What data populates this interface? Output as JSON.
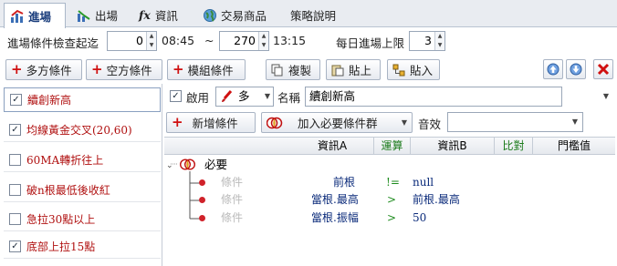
{
  "tabs": [
    {
      "label": "進場",
      "icon": "chart-entry-icon"
    },
    {
      "label": "出場",
      "icon": "chart-exit-icon"
    },
    {
      "label": "資訊",
      "icon": "fx-icon",
      "prefix": "fx"
    },
    {
      "label": "交易商品",
      "icon": "globe-icon"
    },
    {
      "label": "策略說明",
      "icon": ""
    }
  ],
  "settings": {
    "check_label": "進場條件檢查起迄",
    "start_value": "0",
    "start_time": "08:45",
    "range_sep": "~",
    "end_value": "270",
    "end_time": "13:15",
    "daily_label": "每日進場上限",
    "daily_value": "3"
  },
  "toolbar": {
    "long_cond": "多方條件",
    "short_cond": "空方條件",
    "module_cond": "模組條件",
    "copy": "複製",
    "paste1": "貼上",
    "paste2": "貼入"
  },
  "conditions": [
    {
      "label": "續創新高",
      "checked": true
    },
    {
      "label": "均線黃金交叉(20,60)",
      "checked": true
    },
    {
      "label": "60MA轉折往上",
      "checked": false
    },
    {
      "label": "破n根最低後收紅",
      "checked": false
    },
    {
      "label": "急拉30點以上",
      "checked": false
    },
    {
      "label": "底部上拉15點",
      "checked": true
    }
  ],
  "detail": {
    "enable_label": "啟用",
    "direction": "多",
    "name_label": "名稱",
    "name_value": "續創新高",
    "add_cond": "新增條件",
    "add_group": "加入必要條件群",
    "sound_label": "音效",
    "sound_value": ""
  },
  "grid": {
    "headers": [
      "資訊A",
      "運算",
      "資訊B",
      "比對",
      "門檻值"
    ],
    "group_label": "必要",
    "rows": [
      {
        "label": "條件",
        "a": "前根",
        "op": "!=",
        "b": "null"
      },
      {
        "label": "條件",
        "a": "當根.最高",
        "op": ">",
        "b": "前根.最高"
      },
      {
        "label": "條件",
        "a": "當根.振幅",
        "op": ">",
        "b": "50"
      }
    ]
  },
  "colors": {
    "accent_red": "#d01010",
    "header_green": "#1a7a1a",
    "tab_blue": "#1a3d7c"
  }
}
